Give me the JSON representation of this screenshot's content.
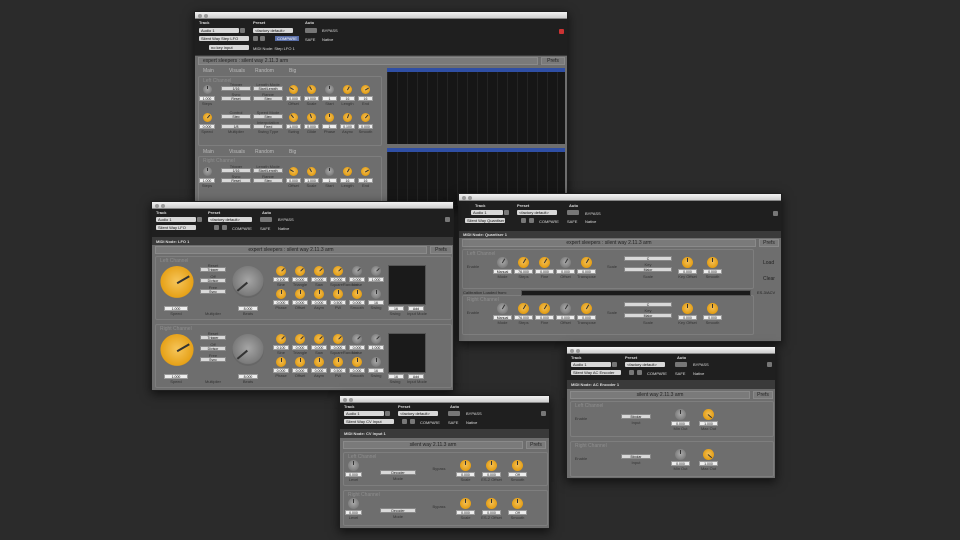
{
  "common": {
    "track_lbl": "Track",
    "preset_lbl": "Preset",
    "auto_lbl": "Auto",
    "preset_name": "<factory default>",
    "compare": "COMPARE",
    "safe": "SAFE",
    "bypass": "BYPASS",
    "native": "Native",
    "audio": "Audio 1",
    "minus": "−",
    "plus": "+",
    "prefs": "Prefs"
  },
  "w1": {
    "insert": "Silent Way Step LFO",
    "sidechain": "no key input",
    "midi_node": "MIDI Node: Step LFO 1",
    "title": "expert sleepers : silent way 2.11.3 arm",
    "tabs": [
      "Main",
      "Visuals",
      "Random",
      "Big"
    ],
    "left_channel": "Left Channel",
    "right_channel": "Right Channel",
    "row_labels_a": [
      "Steps",
      "Offset",
      "Scale",
      "Start",
      "Length",
      "End"
    ],
    "row_labels_b": [
      "Speed",
      "Multiplier",
      "Swing Type",
      "Swing",
      "Glide",
      "Phase",
      "Async",
      "Smooth"
    ],
    "dd_a": [
      "1/16",
      "Start/Length",
      "Reset",
      "Step"
    ],
    "dd_a_labels": [
      "Trigger",
      "Length Mode",
      "Sync",
      "Range"
    ],
    "dd_b": [
      "Step",
      "Step",
      "1/8",
      "Fixed"
    ],
    "dd_b_labels": [
      "Control",
      "Speed Mode",
      "Interpolation"
    ],
    "vals_a": [
      "1.000",
      "0.000",
      "1.000",
      "1",
      "16",
      "16"
    ],
    "vals_b": [
      "0.000",
      "1.000",
      "0.000",
      "1",
      "0.100",
      "0.000"
    ]
  },
  "w2": {
    "insert": "Silent Way LFO",
    "midi_node": "MIDI Node: LFO 1",
    "title": "expert sleepers : silent way 2.11.3 arm",
    "left_channel": "Left Channel",
    "right_channel": "Right Channel",
    "opts": [
      "Reset",
      "Trigger",
      "Off",
      "Divisor",
      "Free",
      "Sync"
    ],
    "knob_labels": [
      "Sine",
      "Triangle",
      "Saw",
      "SquareRandom",
      "Noise"
    ],
    "knob_labels2": [
      "Phase",
      "Offset",
      "Asym",
      "PW",
      "Smooth",
      "Swing",
      "Swing",
      "Input Mode"
    ],
    "big_labels": [
      "Speed",
      "Multiplier",
      "Beats"
    ],
    "vals": [
      "0.100",
      "0.000",
      "0.000",
      "0.000",
      "0.000",
      "1.000"
    ],
    "vals2": [
      "0.000",
      "0.000",
      "0.000",
      "0.500",
      "0.000",
      "16",
      "Add"
    ],
    "speed_val": "1.000",
    "beats_val": "8.000"
  },
  "w3": {
    "insert": "Silent Way Quantiser",
    "midi_node": "MIDI Node: Quantiser 1",
    "title": "expert sleepers : silent way 2.11.3 arm",
    "left_channel": "Left Channel",
    "right_channel": "Right Channel",
    "enable": "Enable",
    "labels": [
      "Mode",
      "Steps",
      "Fine",
      "Offset",
      "Transpose"
    ],
    "vals": [
      "Manual",
      "76.000",
      "0.000",
      "0.000",
      "0.000"
    ],
    "scale": "Scale",
    "key_lbl": "Key",
    "key": "C",
    "scale_sel": "Major",
    "labels_r": [
      "Key Offset",
      "Smooth"
    ],
    "vals_r": [
      "0.000",
      "0.000"
    ],
    "side_btns": [
      "Load",
      "Clear"
    ],
    "calib": "Calibration Loaded from:",
    "side_right": "ES-3/ACV"
  },
  "w4": {
    "insert": "Silent Way AC Encoder",
    "midi_node": "MIDI Node: AC Encoder 1",
    "title": "silent way 2.11.3 arm",
    "left_channel": "Left Channel",
    "right_channel": "Right Channel",
    "enable": "Enable",
    "input_val": "Bipolar",
    "input_lbl": "Input",
    "labels": [
      "Min Out",
      "Max Out"
    ],
    "vals": [
      "0.000",
      "1.000"
    ]
  },
  "w5": {
    "insert": "Silent Way CV Input",
    "midi_node": "MIDI Node: CV Input 1",
    "title": "silent way 2.11.3 arm",
    "left_channel": "Left Channel",
    "right_channel": "Right Channel",
    "level": "Level",
    "mode_val": "Decoder",
    "mode_lbl": "Mode",
    "bypass_lbl": "Bypass",
    "labels": [
      "Scale",
      "ES-2 Offset",
      "Smooth"
    ],
    "vals": [
      "0.000",
      "0.000",
      "Off"
    ]
  }
}
